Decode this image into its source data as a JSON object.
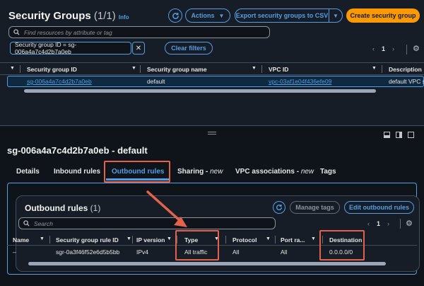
{
  "top": {
    "title": "Security Groups",
    "count": "(1/1)",
    "info": "Info",
    "refresh_icon": "refresh-icon",
    "actions_label": "Actions",
    "export_label": "Export security groups to CSV",
    "create_label": "Create security group",
    "search_placeholder": "Find resources by attribute or tag",
    "filter_token": "Security group ID = sg-006a4a7c4d2b7a0eb",
    "clear_filters": "Clear filters",
    "page_number": "1",
    "columns": [
      "Security group ID",
      "Security group name",
      "VPC ID",
      "Description"
    ],
    "row": {
      "id": "sg-006a4a7c4d2b7a0eb",
      "name": "default",
      "vpc": "vpc-03af1e04f436efe09",
      "description": "default VPC s"
    }
  },
  "detail": {
    "title": "sg-006a4a7c4d2b7a0eb - default",
    "tabs": {
      "details": "Details",
      "inbound": "Inbound rules",
      "outbound": "Outbound rules",
      "sharing": "Sharing - ",
      "sharing_new": "new",
      "vpc_assoc": "VPC associations - ",
      "vpc_new": "new",
      "tags": "Tags"
    },
    "panel": {
      "title": "Outbound rules",
      "count": "(1)",
      "manage_tags": "Manage tags",
      "edit_rules": "Edit outbound rules",
      "search_placeholder": "Search",
      "page_number": "1",
      "columns": [
        "Name",
        "Security group rule ID",
        "IP version",
        "Type",
        "Protocol",
        "Port ra...",
        "Destination"
      ],
      "row": {
        "name": "–",
        "rule_id": "sgr-0a3f46f52e6d5b5bb",
        "ip_version": "IPv4",
        "type": "All traffic",
        "protocol": "All",
        "port": "All",
        "destination": "0.0.0.0/0"
      }
    }
  },
  "colors": {
    "accent": "#539fe5",
    "primary": "#ff9900",
    "highlight": "#e4624b"
  }
}
